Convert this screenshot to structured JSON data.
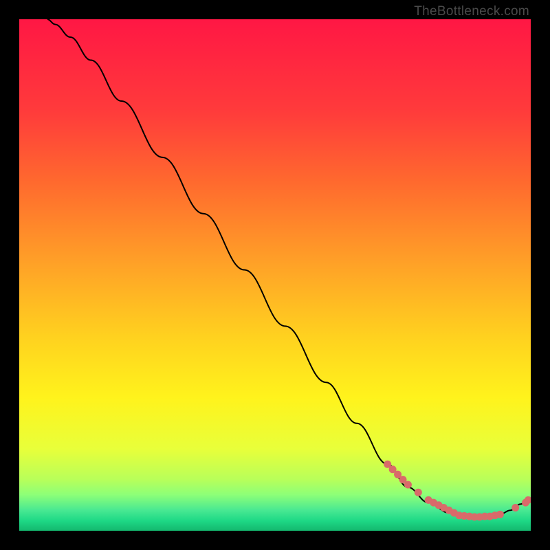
{
  "watermark": "TheBottleneck.com",
  "chart_data": {
    "type": "line",
    "title": "",
    "xlabel": "",
    "ylabel": "",
    "xlim": [
      0,
      100
    ],
    "ylim": [
      0,
      100
    ],
    "series": [
      {
        "name": "curve",
        "x": [
          5.5,
          7,
          10,
          14,
          20,
          28,
          36,
          44,
          52,
          60,
          66,
          72,
          76,
          80,
          84,
          86,
          88,
          90,
          92,
          93,
          94,
          96,
          98,
          99.5
        ],
        "y": [
          100,
          99,
          96.5,
          92,
          84,
          73,
          62,
          51,
          40,
          29,
          21,
          13,
          8.5,
          5.5,
          3.5,
          3,
          2.8,
          2.7,
          2.8,
          3,
          3.2,
          4,
          5.2,
          6
        ]
      }
    ],
    "markers": [
      {
        "x": 72,
        "y": 13
      },
      {
        "x": 73,
        "y": 12
      },
      {
        "x": 74,
        "y": 11
      },
      {
        "x": 75,
        "y": 10
      },
      {
        "x": 76,
        "y": 9
      },
      {
        "x": 78,
        "y": 7.5
      },
      {
        "x": 80,
        "y": 6
      },
      {
        "x": 81,
        "y": 5.5
      },
      {
        "x": 82,
        "y": 5
      },
      {
        "x": 83,
        "y": 4.5
      },
      {
        "x": 84,
        "y": 4
      },
      {
        "x": 85,
        "y": 3.5
      },
      {
        "x": 86,
        "y": 3
      },
      {
        "x": 87,
        "y": 2.9
      },
      {
        "x": 88,
        "y": 2.8
      },
      {
        "x": 89,
        "y": 2.7
      },
      {
        "x": 90,
        "y": 2.7
      },
      {
        "x": 91,
        "y": 2.8
      },
      {
        "x": 92,
        "y": 2.8
      },
      {
        "x": 93,
        "y": 3
      },
      {
        "x": 94,
        "y": 3.2
      },
      {
        "x": 97,
        "y": 4.5
      },
      {
        "x": 99,
        "y": 5.5
      },
      {
        "x": 99.5,
        "y": 6
      }
    ],
    "gradient_stops": [
      {
        "offset": 0,
        "color": "#ff1744"
      },
      {
        "offset": 18,
        "color": "#ff3b3b"
      },
      {
        "offset": 32,
        "color": "#ff6a2e"
      },
      {
        "offset": 48,
        "color": "#ffa227"
      },
      {
        "offset": 62,
        "color": "#ffd11f"
      },
      {
        "offset": 74,
        "color": "#fff31c"
      },
      {
        "offset": 84,
        "color": "#e8ff3a"
      },
      {
        "offset": 90,
        "color": "#b8ff5a"
      },
      {
        "offset": 93,
        "color": "#8cff78"
      },
      {
        "offset": 96,
        "color": "#48e892"
      },
      {
        "offset": 98,
        "color": "#1ed986"
      },
      {
        "offset": 100,
        "color": "#14b86e"
      }
    ]
  }
}
